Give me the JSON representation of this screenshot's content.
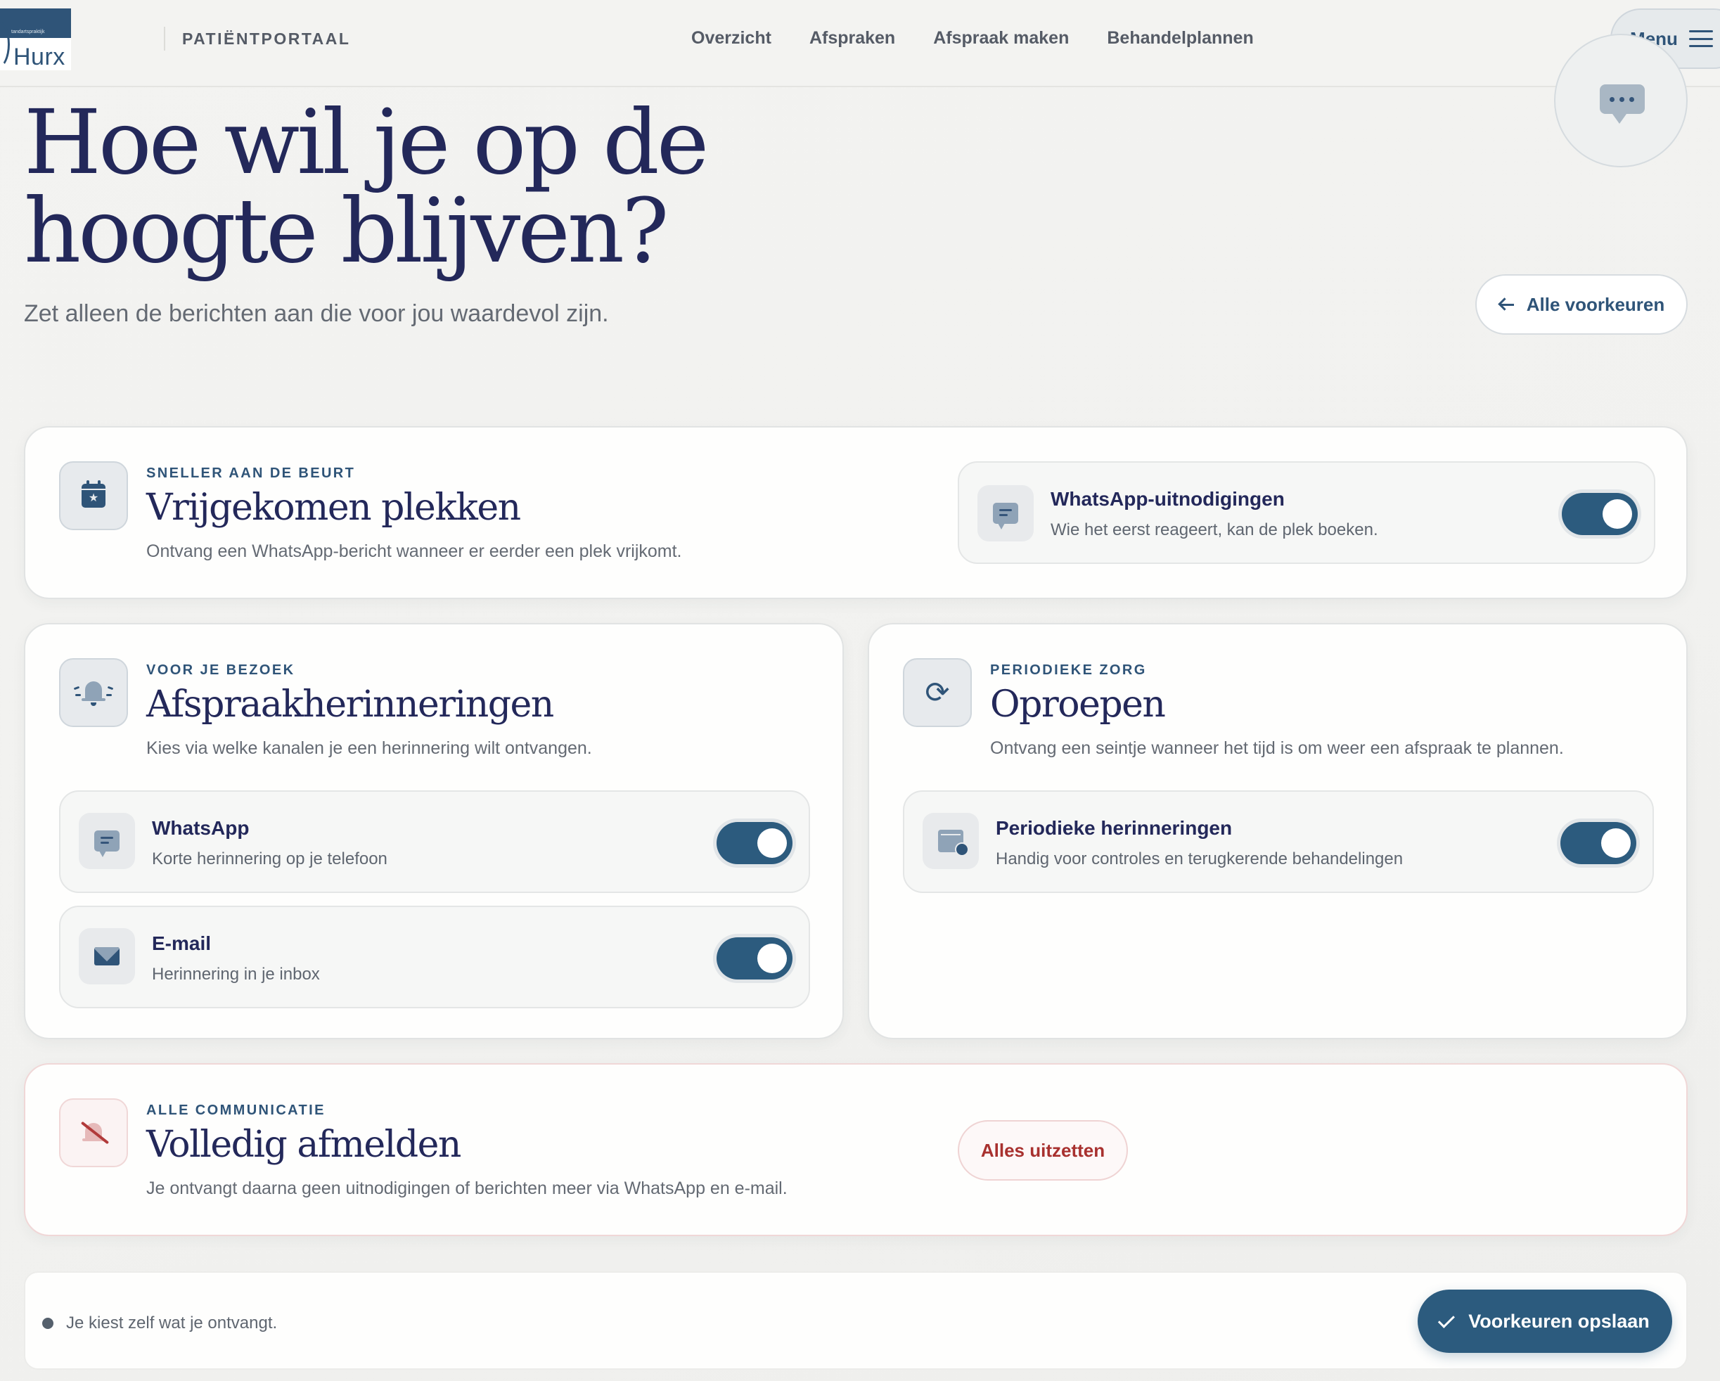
{
  "header": {
    "logo": {
      "small_text": "tandartspraktijk",
      "word": "Hurx"
    },
    "portal_label": "PATIËNTPORTAAL",
    "nav": [
      "Overzicht",
      "Afspraken",
      "Afspraak maken",
      "Behandelplannen"
    ],
    "menu_label": "Menu"
  },
  "hero": {
    "title_line1": "Hoe wil je op de",
    "title_line2": "hoogte blijven?",
    "subtitle": "Zet alleen de berichten aan die voor jou waardevol zijn.",
    "back_button": "Alle voorkeuren"
  },
  "cards": {
    "free_slots": {
      "eyebrow": "SNELLER AAN DE BEURT",
      "title": "Vrijgekomen plekken",
      "desc": "Ontvang een WhatsApp-bericht wanneer er eerder een plek vrijkomt.",
      "icon": "calendar-star-icon",
      "row": {
        "title": "WhatsApp-uitnodigingen",
        "desc": "Wie het eerst reageert, kan de plek boeken.",
        "enabled": true,
        "icon": "chat-icon"
      }
    },
    "reminders": {
      "eyebrow": "VOOR JE BEZOEK",
      "title": "Afspraakherinneringen",
      "desc": "Kies via welke kanalen je een herinnering wilt ontvangen.",
      "icon": "bell-ringing-icon",
      "rows": [
        {
          "title": "WhatsApp",
          "desc": "Korte herinnering op je telefoon",
          "enabled": true,
          "icon": "chat-icon"
        },
        {
          "title": "E-mail",
          "desc": "Herinnering in je inbox",
          "enabled": true,
          "icon": "mail-icon"
        }
      ]
    },
    "recalls": {
      "eyebrow": "PERIODIEKE ZORG",
      "title": "Oproepen",
      "desc": "Ontvang een seintje wanneer het tijd is om weer een afspraak te plannen.",
      "icon": "refresh-icon",
      "row": {
        "title": "Periodieke herinneringen",
        "desc": "Handig voor controles en terugkerende behandelingen",
        "enabled": true,
        "icon": "calendar-clock-icon"
      }
    },
    "unsubscribe": {
      "eyebrow": "ALLE COMMUNICATIE",
      "title": "Volledig afmelden",
      "desc": "Je ontvangt daarna geen uitnodigingen of berichten meer via WhatsApp en e-mail.",
      "icon": "bell-off-icon",
      "button": "Alles uitzetten"
    }
  },
  "footer": {
    "note": "Je kiest zelf wat je ontvangt.",
    "save_button": "Voorkeuren opslaan"
  },
  "colors": {
    "primary": "#2c5b7e",
    "navy_text": "#23285a",
    "danger": "#a8312f",
    "background": "#f2f2f0"
  }
}
